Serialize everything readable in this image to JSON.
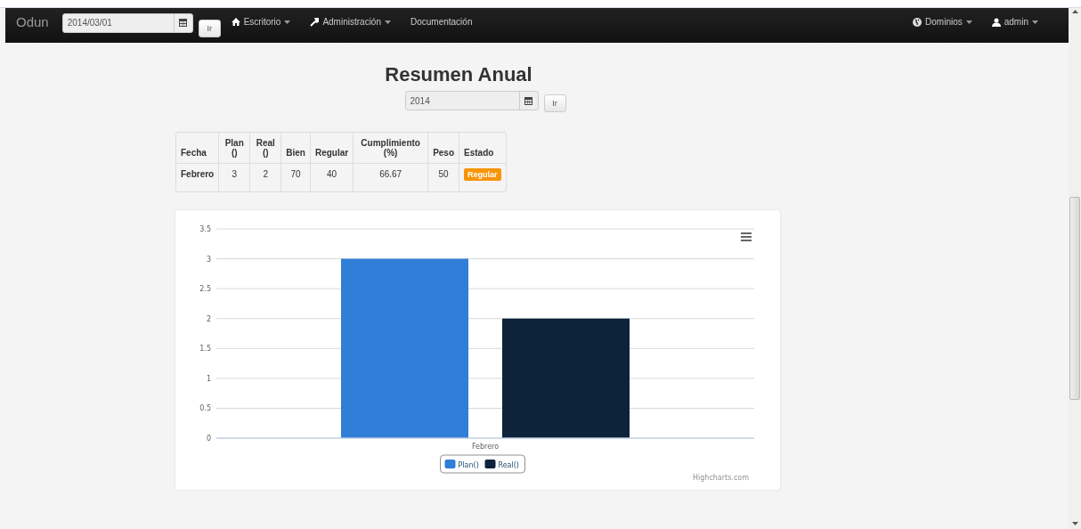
{
  "navbar": {
    "brand": "Odun",
    "date_field": {
      "value": "2014/03/01"
    },
    "go_button": "Ir",
    "menus": [
      {
        "label": "Escritorio",
        "dropdown": true
      },
      {
        "label": "Administración",
        "dropdown": true
      },
      {
        "label": "Documentación",
        "dropdown": false
      }
    ],
    "right_menus": [
      {
        "label": "Dominios",
        "dropdown": true
      },
      {
        "label": "admin",
        "dropdown": true
      }
    ]
  },
  "title": "Resumen Anual",
  "year_field": {
    "value": "2014"
  },
  "year_button": "Ir",
  "table": {
    "columns": [
      "Fecha",
      "Plan ()",
      "Real ()",
      "Bien",
      "Regular",
      "Cumplimiento (%)",
      "Peso",
      "Estado"
    ],
    "rows": [
      {
        "cells": [
          "Febrero",
          "3",
          "2",
          "70",
          "40",
          "66.67",
          "50"
        ],
        "status": {
          "label": "Regular",
          "kind": "warning"
        }
      }
    ]
  },
  "chart": {
    "credits": "Highcharts.com",
    "chart_data": {
      "type": "bar",
      "orientation": "vertical",
      "categories": [
        "Febrero"
      ],
      "series": [
        {
          "name": "Plan()",
          "color": "#2f7ed8",
          "values": [
            3
          ]
        },
        {
          "name": "Real()",
          "color": "#0d233a",
          "values": [
            2
          ]
        }
      ],
      "ylim": [
        0,
        3.5
      ],
      "grid": true,
      "legend": true,
      "yticks": [
        0,
        0.5,
        1,
        1.5,
        2,
        2.5,
        3,
        3.5
      ]
    }
  }
}
